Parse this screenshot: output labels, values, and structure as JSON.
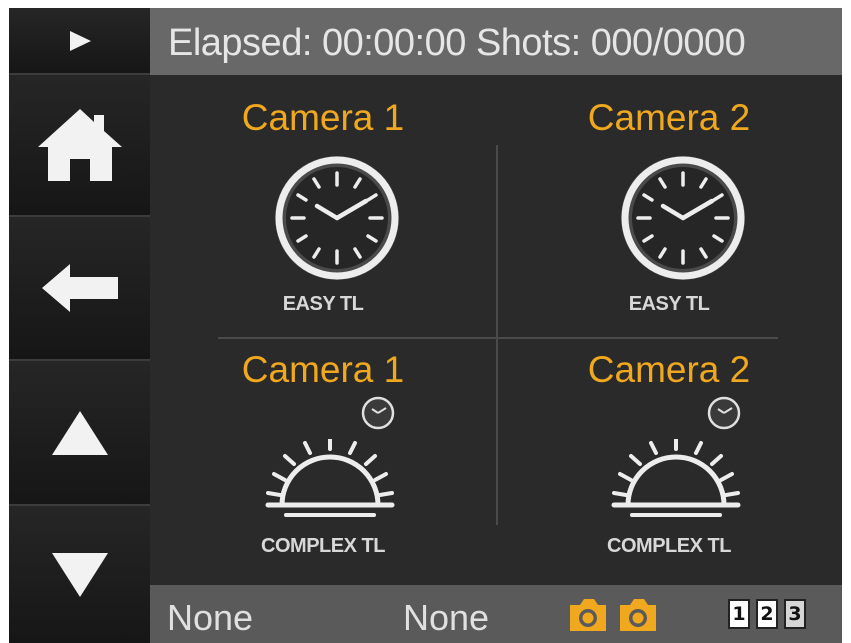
{
  "header": {
    "elapsed_label": "Elapsed:",
    "elapsed_value": "00:00:00",
    "shots_label": "Shots:",
    "shots_value": "000/0000"
  },
  "sidebar": {
    "buttons": [
      "play",
      "home",
      "back",
      "up",
      "down"
    ]
  },
  "tiles": [
    {
      "camera": "Camera 1",
      "mode": "EASY TL",
      "icon": "clock-icon"
    },
    {
      "camera": "Camera 2",
      "mode": "EASY TL",
      "icon": "clock-icon"
    },
    {
      "camera": "Camera 1",
      "mode": "COMPLEX TL",
      "icon": "sunrise-icon"
    },
    {
      "camera": "Camera 2",
      "mode": "COMPLEX TL",
      "icon": "sunrise-icon"
    }
  ],
  "footer": {
    "status_1": "None",
    "status_2": "None",
    "camera_icon_color": "#f0a81e",
    "numbers": [
      "1",
      "2",
      "3"
    ]
  },
  "colors": {
    "accent": "#f0a81e",
    "header_bg": "#686868",
    "panel_bg": "#2a2a2a"
  }
}
